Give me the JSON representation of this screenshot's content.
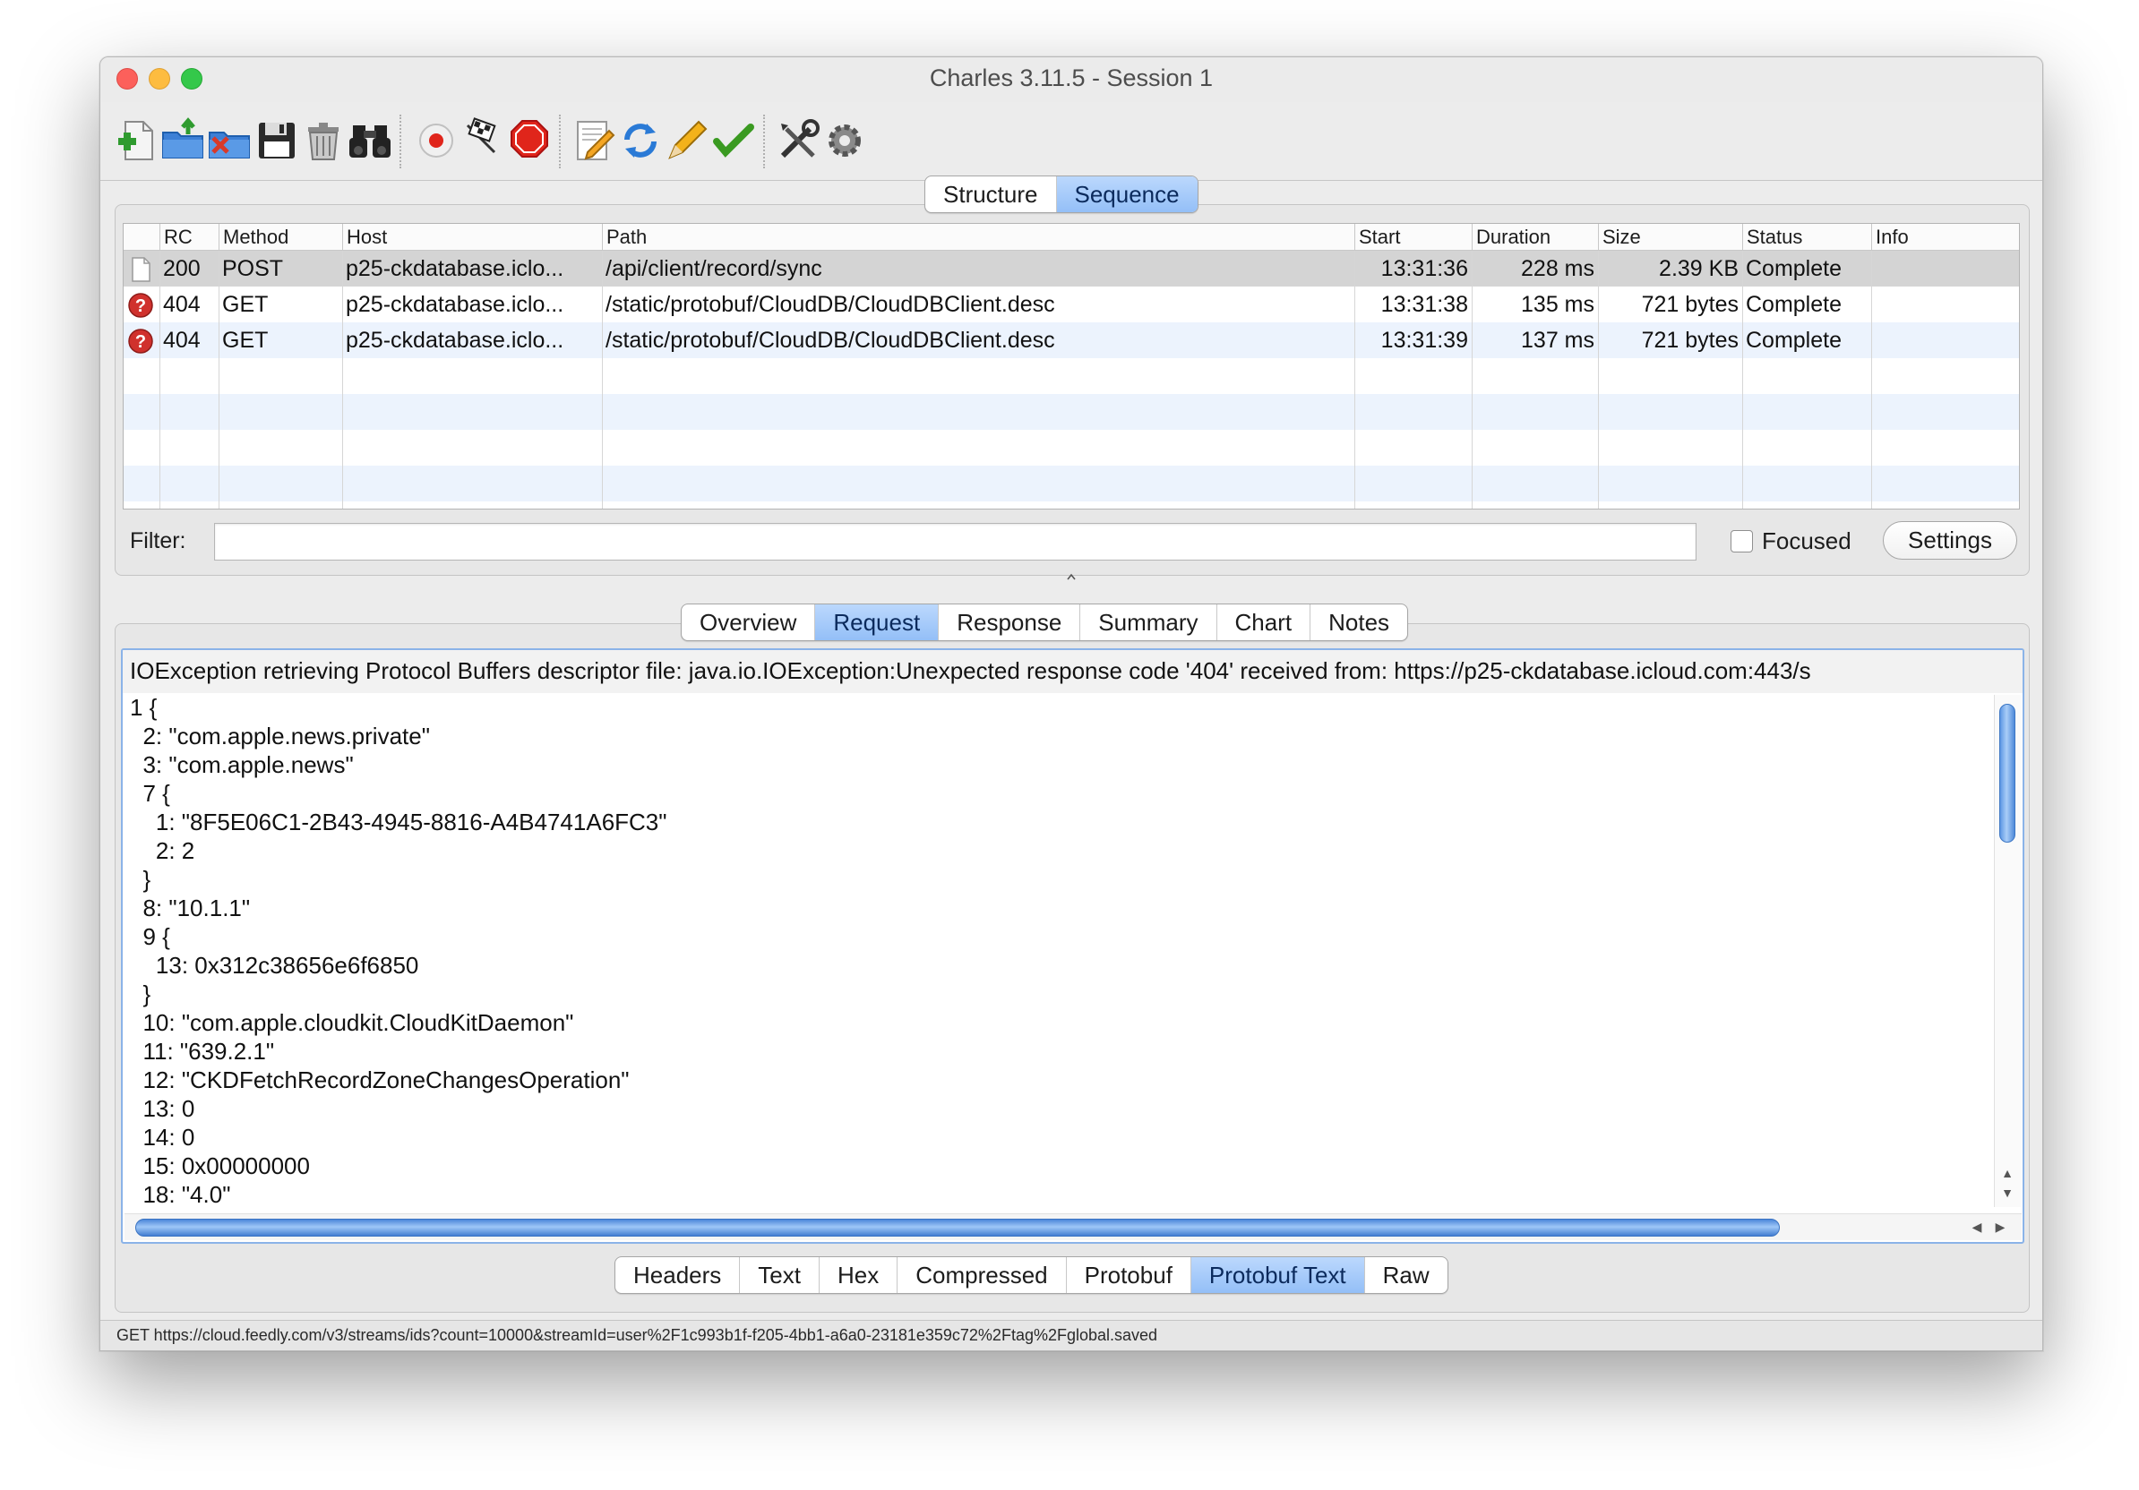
{
  "window": {
    "title": "Charles 3.11.5 - Session 1"
  },
  "toolbar": {
    "buttons": [
      {
        "icon": "new-session-icon"
      },
      {
        "icon": "open-session-icon"
      },
      {
        "icon": "close-session-icon"
      },
      {
        "icon": "save-session-icon"
      },
      {
        "icon": "clear-session-icon"
      },
      {
        "icon": "find-icon"
      },
      {
        "icon": "record-icon"
      },
      {
        "icon": "throttle-icon"
      },
      {
        "icon": "breakpoints-icon"
      },
      {
        "icon": "compose-icon"
      },
      {
        "icon": "repeat-icon"
      },
      {
        "icon": "edit-icon"
      },
      {
        "icon": "validate-icon"
      },
      {
        "icon": "tools-icon"
      },
      {
        "icon": "settings-icon"
      }
    ]
  },
  "view_tabs": {
    "structure": "Structure",
    "sequence": "Sequence",
    "active": "Sequence"
  },
  "table": {
    "columns": [
      "RC",
      "Method",
      "Host",
      "Path",
      "Start",
      "Duration",
      "Size",
      "Status",
      "Info"
    ],
    "rows": [
      {
        "icon": "document-icon",
        "rc": "200",
        "method": "POST",
        "host": "p25-ckdatabase.iclo...",
        "path": "/api/client/record/sync",
        "start": "13:31:36",
        "duration": "228 ms",
        "size": "2.39 KB",
        "status": "Complete",
        "info": ""
      },
      {
        "icon": "error-icon",
        "rc": "404",
        "method": "GET",
        "host": "p25-ckdatabase.iclo...",
        "path": "/static/protobuf/CloudDB/CloudDBClient.desc",
        "start": "13:31:38",
        "duration": "135 ms",
        "size": "721 bytes",
        "status": "Complete",
        "info": ""
      },
      {
        "icon": "error-icon",
        "rc": "404",
        "method": "GET",
        "host": "p25-ckdatabase.iclo...",
        "path": "/static/protobuf/CloudDB/CloudDBClient.desc",
        "start": "13:31:39",
        "duration": "137 ms",
        "size": "721 bytes",
        "status": "Complete",
        "info": ""
      }
    ]
  },
  "filter": {
    "label": "Filter:",
    "value": "",
    "focused_label": "Focused",
    "focused_checked": false,
    "settings_label": "Settings"
  },
  "detail_tabs": {
    "items": [
      "Overview",
      "Request",
      "Response",
      "Summary",
      "Chart",
      "Notes"
    ],
    "active": "Request"
  },
  "content": {
    "error": "IOException retrieving Protocol Buffers descriptor file: java.io.IOException:Unexpected response code '404' received from: https://p25-ckdatabase.icloud.com:443/s",
    "lines": [
      "1 {",
      "  2: \"com.apple.news.private\"",
      "  3: \"com.apple.news\"",
      "  7 {",
      "    1: \"8F5E06C1-2B43-4945-8816-A4B4741A6FC3\"",
      "    2: 2",
      "  }",
      "  8: \"10.1.1\"",
      "  9 {",
      "    13: 0x312c38656e6f6850",
      "  }",
      "  10: \"com.apple.cloudkit.CloudKitDaemon\"",
      "  11: \"639.2.1\"",
      "  12: \"CKDFetchRecordZoneChangesOperation\"",
      "  13: 0",
      "  14: 0",
      "  15: 0x00000000",
      "  18: \"4.0\""
    ]
  },
  "format_tabs": {
    "items": [
      "Headers",
      "Text",
      "Hex",
      "Compressed",
      "Protobuf",
      "Protobuf Text",
      "Raw"
    ],
    "active": "Protobuf Text"
  },
  "statusbar": {
    "text": "GET https://cloud.feedly.com/v3/streams/ids?count=10000&streamId=user%2F1c993b1f-f205-4bb1-a6a0-23181e359c72%2Ftag%2Fglobal.saved"
  },
  "colors": {
    "accent": "#94bff7",
    "selected_row": "#d4d4d4",
    "alt_row": "#ecf3fd",
    "error_red": "#d0312d"
  }
}
